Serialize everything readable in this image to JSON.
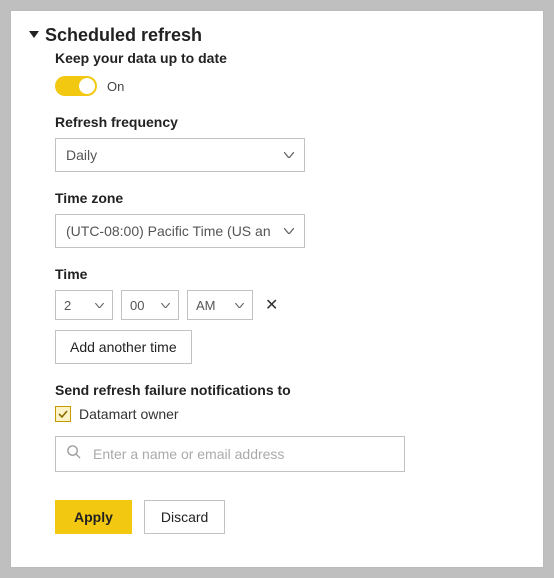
{
  "section": {
    "title": "Scheduled refresh",
    "keep_label": "Keep your data up to date",
    "toggle_state": "On",
    "frequency_label": "Refresh frequency",
    "frequency_value": "Daily",
    "timezone_label": "Time zone",
    "timezone_value": "(UTC-08:00) Pacific Time (US an",
    "time_label": "Time",
    "time": {
      "hour": "2",
      "minute": "00",
      "ampm": "AM"
    },
    "add_time_label": "Add another time",
    "notify_label": "Send refresh failure notifications to",
    "notify_owner_label": "Datamart owner",
    "search_placeholder": "Enter a name or email address",
    "apply_label": "Apply",
    "discard_label": "Discard"
  }
}
